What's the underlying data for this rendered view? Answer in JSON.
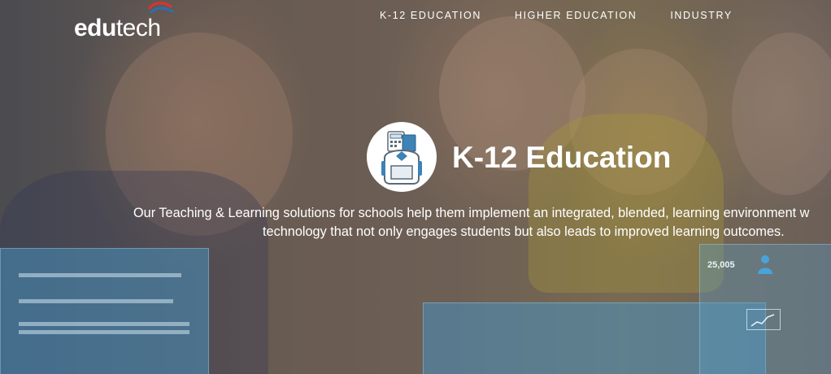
{
  "brand": {
    "logo_bold": "edu",
    "logo_light": "tech"
  },
  "nav": {
    "items": [
      {
        "label": "K-12 EDUCATION"
      },
      {
        "label": "HIGHER EDUCATION"
      },
      {
        "label": "INDUSTRY"
      }
    ]
  },
  "hero": {
    "title": "K-12 Education",
    "description_line1": "Our Teaching & Learning solutions for schools help them implement an integrated, blended, learning environment w",
    "description_line2": "technology that not only engages students but also leads to improved learning outcomes.",
    "badge_icon": "backpack-icon",
    "stat_value": "25,005"
  },
  "colors": {
    "text": "#ffffff",
    "badge_bg": "#ffffff",
    "icon_blue": "#3e82b6",
    "logo_red": "#e0322f",
    "logo_blue": "#2a6fb7"
  }
}
